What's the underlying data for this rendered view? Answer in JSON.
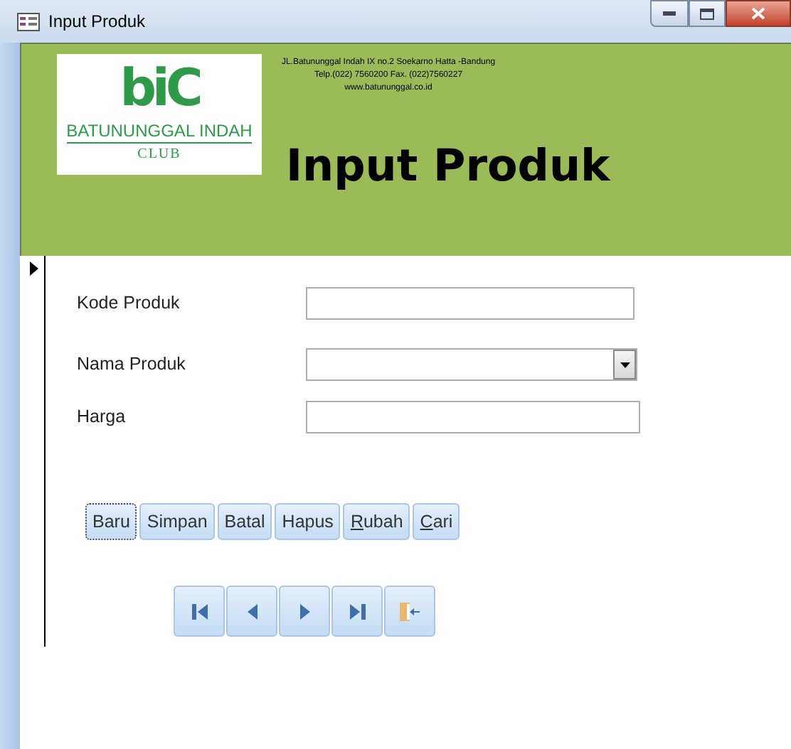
{
  "window": {
    "title": "Input Produk"
  },
  "header": {
    "logo": {
      "mark": "biC",
      "name": "BATUNUNGGAL INDAH",
      "sub": "CLUB"
    },
    "address": [
      "JL.Batununggal Indah IX no.2 Soekarno Hatta -Bandung",
      "Telp.(022) 7560200 Fax. (022)7560227",
      "www.batununggal.co.id"
    ],
    "title": "Input Produk"
  },
  "fields": [
    {
      "label": "Kode Produk",
      "kind": "text"
    },
    {
      "label": "Nama Produk",
      "kind": "combo"
    },
    {
      "label": "Harga",
      "kind": "text"
    }
  ],
  "buttons": [
    {
      "label": "Baru",
      "focused": true,
      "first_letter_underlined": false
    },
    {
      "label": "Simpan",
      "focused": false,
      "first_letter_underlined": false
    },
    {
      "label": "Batal",
      "focused": false,
      "first_letter_underlined": false
    },
    {
      "label": "Hapus",
      "focused": false,
      "first_letter_underlined": false
    },
    {
      "label": "Rubah",
      "focused": false,
      "first_letter_underlined": true
    },
    {
      "label": "Cari",
      "focused": false,
      "first_letter_underlined": true
    }
  ],
  "navigation": [
    {
      "kind": "first"
    },
    {
      "kind": "previous"
    },
    {
      "kind": "next"
    },
    {
      "kind": "last"
    },
    {
      "kind": "exit"
    }
  ]
}
